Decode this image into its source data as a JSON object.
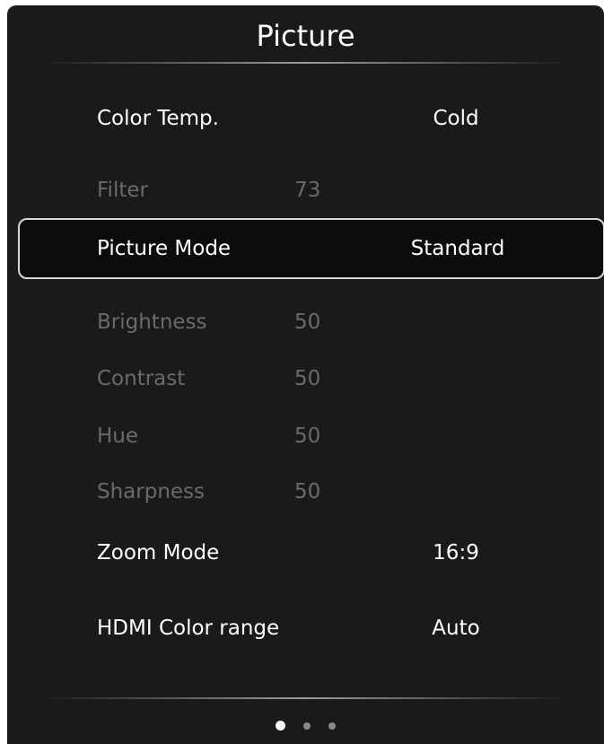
{
  "title": "Picture",
  "settings": [
    {
      "label": "Color Temp.",
      "value": "Cold",
      "enabled": true
    },
    {
      "label": "Filter",
      "value": "73",
      "enabled": false
    },
    {
      "label": "Picture Mode",
      "value": "Standard",
      "enabled": true,
      "selected": true
    },
    {
      "label": "Brightness",
      "value": "50",
      "enabled": false
    },
    {
      "label": "Contrast",
      "value": "50",
      "enabled": false
    },
    {
      "label": "Hue",
      "value": "50",
      "enabled": false
    },
    {
      "label": "Sharpness",
      "value": "50",
      "enabled": false
    },
    {
      "label": "Zoom Mode",
      "value": "16:9",
      "enabled": true
    },
    {
      "label": "HDMI Color range",
      "value": "Auto",
      "enabled": true
    }
  ],
  "pagination": {
    "total": 3,
    "current": 1
  },
  "colors": {
    "background": "#1a1a1a",
    "enabled_text": "#ffffff",
    "disabled_text": "#6a6a6a",
    "selection_border": "#d8d8d8"
  }
}
